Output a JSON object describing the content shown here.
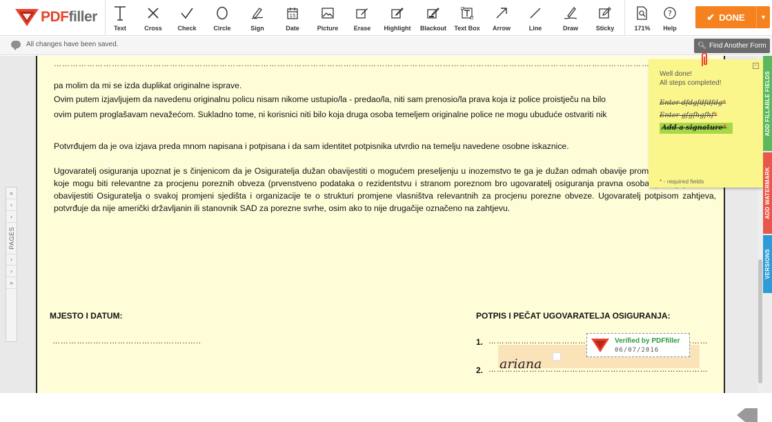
{
  "app": {
    "logo_text": "PDF",
    "logo_text2": "filler"
  },
  "toolbar": {
    "tools": [
      {
        "label": "Text",
        "icon": "text-icon"
      },
      {
        "label": "Cross",
        "icon": "cross-icon"
      },
      {
        "label": "Check",
        "icon": "check-icon"
      },
      {
        "label": "Circle",
        "icon": "circle-icon"
      },
      {
        "label": "Sign",
        "icon": "sign-icon"
      },
      {
        "label": "Date",
        "icon": "date-icon"
      },
      {
        "label": "Picture",
        "icon": "picture-icon"
      },
      {
        "label": "Erase",
        "icon": "erase-icon"
      },
      {
        "label": "Highlight",
        "icon": "highlight-icon"
      },
      {
        "label": "Blackout",
        "icon": "blackout-icon"
      },
      {
        "label": "Text Box",
        "icon": "text-box-icon"
      },
      {
        "label": "Arrow",
        "icon": "arrow-icon"
      },
      {
        "label": "Line",
        "icon": "line-icon"
      },
      {
        "label": "Draw",
        "icon": "draw-icon"
      },
      {
        "label": "Sticky",
        "icon": "sticky-icon"
      },
      {
        "label": "171%",
        "icon": "zoom-icon"
      },
      {
        "label": "Help",
        "icon": "help-icon"
      }
    ],
    "done_label": "DONE",
    "accent_color": "#f5821f"
  },
  "status": {
    "save_text": "All changes have been saved.",
    "find_button": "Find Another Form"
  },
  "pages_nav": {
    "label": "PAGES"
  },
  "document": {
    "dots_top": "………………………………………………………………………………………………………………………………………………………………………………………………………………………………………………………………………",
    "line1": "pa molim da mi se izda duplikat originalne isprave.",
    "line2": "Ovim putem izjavljujem da navedenu originalnu policu nisam nikome ustupio/la - predao/la, niti sam prenosio/la prava koja iz police proistječu na bilo",
    "line3": "ovim putem proglašavam nevažećom. Sukladno tome, ni korisnici niti bilo koja druga osoba temeljem originalne police ne mogu ubuduće ostvariti nik",
    "line4": "Potvrđujem da je ova izjava preda mnom napisana i potpisana i da sam identitet potpisnika utvrdio na temelju navedene osobne iskaznice.",
    "para": "Ugovaratelj osiguranja upoznat je s činjenicom da je Osiguratelja dužan obavijestiti o mogućem preseljenju u inozemstvo te ga je dužan odmah obavije promjenama podataka, koje mogu biti relevantne za procjenu poreznih obveza (prvenstveno podataka o rezidentstvu i stranom poreznom bro ugovaratelj osiguranja pravna osoba, potonji je dužan obavijestiti Osiguratelja o svakoj promjeni sjedišta i organizacije te o strukturi promjene vlasništva relevantnih za procjenu porezne obveze. Ugovaratelj potpisom zahtjeva, potvrđuje da nije američki državljanin ili stanovnik SAD za porezne svrhe, osim ako to nije drugačije označeno na zahtjevu.",
    "heading_left": "MJESTO I DATUM:",
    "heading_right": "POTPIS I PEČAT UGOVARATELJA OSIGURANJA:",
    "dots_left": "………………………………..…….…..…..",
    "num1": "1.",
    "num2": "2.",
    "dots_right1": "…………………………………………………………………………",
    "dots_right2": "…………………………………………………………………………",
    "signature_text": "ariana",
    "verified_title": "Verified by PDFfiller",
    "verified_date": "06/07/2016"
  },
  "sticky": {
    "title1": "Well done!",
    "title2": "All steps completed!",
    "steps": [
      {
        "label": "Enter dfdgfdfdfdg"
      },
      {
        "label": "Enter gfgfhgfhf"
      },
      {
        "label": "Add a signature"
      }
    ],
    "required_mark": "*",
    "legend": " - required fields"
  },
  "side_tabs": [
    {
      "label": "ADD FILLABLE FIELDS",
      "color": "#5cb85c"
    },
    {
      "label": "ADD WATERMARK",
      "color": "#e8574a"
    },
    {
      "label": "VERSIONS",
      "color": "#2d9cd6"
    }
  ]
}
